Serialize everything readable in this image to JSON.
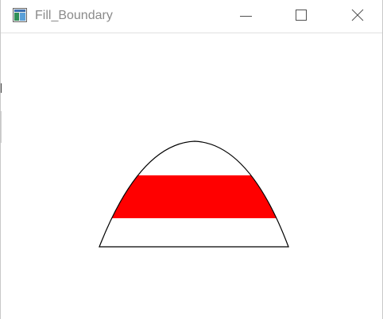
{
  "window": {
    "title": "Fill_Boundary",
    "title_color": "#8a8a8a",
    "icon": "app-window-icon",
    "controls": {
      "minimize_icon": "minimize-icon",
      "maximize_icon": "maximize-icon",
      "close_icon": "close-icon"
    }
  },
  "canvas": {
    "background": "#ffffff",
    "shape": "parabolic-arch-outline",
    "outline_color": "#000000",
    "fill_band": {
      "color": "#ff0000"
    }
  }
}
